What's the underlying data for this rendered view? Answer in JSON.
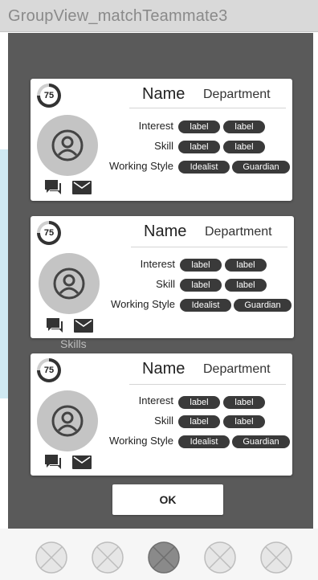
{
  "window": {
    "title": "GroupView_matchTeammate3"
  },
  "background": {
    "skills_label": "Skills"
  },
  "cards": [
    {
      "score": "75",
      "name": "Name",
      "department": "Department",
      "interest_label": "Interest",
      "interest_tags": [
        "label",
        "label"
      ],
      "skill_label": "Skill",
      "skill_tags": [
        "label",
        "label"
      ],
      "style_label": "Working Style",
      "style_tags": [
        "Idealist",
        "Guardian"
      ]
    },
    {
      "score": "75",
      "name": "Name",
      "department": "Department",
      "interest_label": "Interest",
      "interest_tags": [
        "label",
        "label"
      ],
      "skill_label": "Skill",
      "skill_tags": [
        "label",
        "label"
      ],
      "style_label": "Working Style",
      "style_tags": [
        "Idealist",
        "Guardian"
      ]
    },
    {
      "score": "75",
      "name": "Name",
      "department": "Department",
      "interest_label": "Interest",
      "interest_tags": [
        "label",
        "label"
      ],
      "skill_label": "Skill",
      "skill_tags": [
        "label",
        "label"
      ],
      "style_label": "Working Style",
      "style_tags": [
        "Idealist",
        "Guardian"
      ]
    }
  ],
  "dialog": {
    "ok_label": "OK"
  },
  "icons": {
    "avatar": "person-circle-icon",
    "chat": "chat-icon",
    "mail": "mail-icon",
    "nav": "x-circle-icon"
  },
  "colors": {
    "overlay": "#5a5a5a",
    "pill": "#3a3a3a",
    "avatar": "#c4c4c4"
  }
}
